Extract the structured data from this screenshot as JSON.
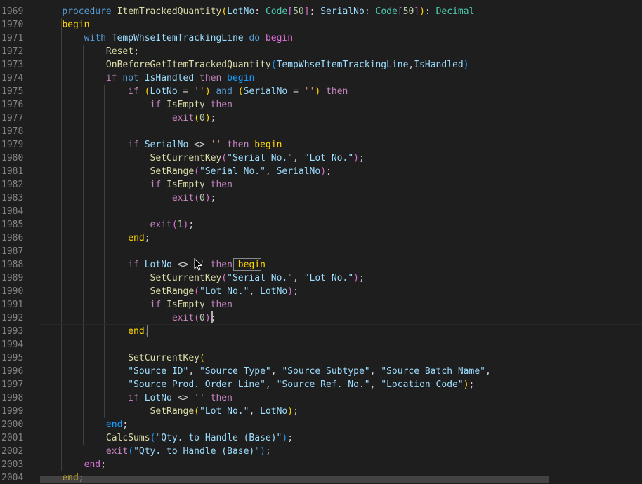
{
  "editor": {
    "lines": [
      {
        "num": "1969",
        "tokens": [
          [
            "    ",
            "t-txt"
          ],
          [
            "procedure",
            "t-kw"
          ],
          [
            " ",
            "t-txt"
          ],
          [
            "ItemTrackedQuantity",
            "t-fn"
          ],
          [
            "(",
            "t-yel"
          ],
          [
            "LotNo",
            "t-var"
          ],
          [
            ": ",
            "t-txt"
          ],
          [
            "Code",
            "t-type"
          ],
          [
            "[",
            "t-pink"
          ],
          [
            "50",
            "t-num"
          ],
          [
            "]",
            "t-pink"
          ],
          [
            "; ",
            "t-txt"
          ],
          [
            "SerialNo",
            "t-var"
          ],
          [
            ": ",
            "t-txt"
          ],
          [
            "Code",
            "t-type"
          ],
          [
            "[",
            "t-pink"
          ],
          [
            "50",
            "t-num"
          ],
          [
            "]",
            "t-pink"
          ],
          [
            ")",
            "t-yel"
          ],
          [
            ": ",
            "t-txt"
          ],
          [
            "Decimal",
            "t-type"
          ]
        ]
      },
      {
        "num": "1970",
        "tokens": [
          [
            "    ",
            "t-txt"
          ],
          [
            "begin",
            "t-yel"
          ]
        ]
      },
      {
        "num": "1971",
        "tokens": [
          [
            "        ",
            "t-txt"
          ],
          [
            "with",
            "t-kw"
          ],
          [
            " ",
            "t-txt"
          ],
          [
            "TempWhseItemTrackingLine",
            "t-var"
          ],
          [
            " ",
            "t-txt"
          ],
          [
            "do",
            "t-kw"
          ],
          [
            " ",
            "t-txt"
          ],
          [
            "begin",
            "t-pink"
          ]
        ]
      },
      {
        "num": "1972",
        "tokens": [
          [
            "            ",
            "t-txt"
          ],
          [
            "Reset",
            "t-fn"
          ],
          [
            ";",
            "t-txt"
          ]
        ]
      },
      {
        "num": "1973",
        "tokens": [
          [
            "            ",
            "t-txt"
          ],
          [
            "OnBeforeGetItemTrackedQuantity",
            "t-fn"
          ],
          [
            "(",
            "t-blue"
          ],
          [
            "TempWhseItemTrackingLine",
            "t-var"
          ],
          [
            ",",
            "t-txt"
          ],
          [
            "IsHandled",
            "t-var"
          ],
          [
            ")",
            "t-blue"
          ]
        ]
      },
      {
        "num": "1974",
        "tokens": [
          [
            "            ",
            "t-txt"
          ],
          [
            "if",
            "t-ctl"
          ],
          [
            " ",
            "t-txt"
          ],
          [
            "not",
            "t-kw"
          ],
          [
            " ",
            "t-txt"
          ],
          [
            "IsHandled",
            "t-var"
          ],
          [
            " ",
            "t-txt"
          ],
          [
            "then",
            "t-ctl"
          ],
          [
            " ",
            "t-txt"
          ],
          [
            "begin",
            "t-blue"
          ]
        ]
      },
      {
        "num": "1975",
        "tokens": [
          [
            "                ",
            "t-txt"
          ],
          [
            "if",
            "t-ctl"
          ],
          [
            " ",
            "t-txt"
          ],
          [
            "(",
            "t-yel"
          ],
          [
            "LotNo",
            "t-var"
          ],
          [
            " = ",
            "t-txt"
          ],
          [
            "''",
            "t-str"
          ],
          [
            ")",
            "t-yel"
          ],
          [
            " ",
            "t-txt"
          ],
          [
            "and",
            "t-kw"
          ],
          [
            " ",
            "t-txt"
          ],
          [
            "(",
            "t-yel"
          ],
          [
            "SerialNo",
            "t-var"
          ],
          [
            " = ",
            "t-txt"
          ],
          [
            "''",
            "t-str"
          ],
          [
            ")",
            "t-yel"
          ],
          [
            " ",
            "t-txt"
          ],
          [
            "then",
            "t-ctl"
          ]
        ]
      },
      {
        "num": "1976",
        "tokens": [
          [
            "                    ",
            "t-txt"
          ],
          [
            "if",
            "t-ctl"
          ],
          [
            " ",
            "t-txt"
          ],
          [
            "IsEmpty",
            "t-fn"
          ],
          [
            " ",
            "t-txt"
          ],
          [
            "then",
            "t-ctl"
          ]
        ]
      },
      {
        "num": "1977",
        "tokens": [
          [
            "                        ",
            "t-txt"
          ],
          [
            "exit",
            "t-ctl"
          ],
          [
            "(",
            "t-yel"
          ],
          [
            "0",
            "t-num"
          ],
          [
            ")",
            "t-yel"
          ],
          [
            ";",
            "t-txt"
          ]
        ]
      },
      {
        "num": "1978",
        "tokens": []
      },
      {
        "num": "1979",
        "tokens": [
          [
            "                ",
            "t-txt"
          ],
          [
            "if",
            "t-ctl"
          ],
          [
            " ",
            "t-txt"
          ],
          [
            "SerialNo",
            "t-var"
          ],
          [
            " <> ",
            "t-txt"
          ],
          [
            "''",
            "t-str"
          ],
          [
            " ",
            "t-txt"
          ],
          [
            "then",
            "t-ctl"
          ],
          [
            " ",
            "t-txt"
          ],
          [
            "begin",
            "t-yel"
          ]
        ]
      },
      {
        "num": "1980",
        "tokens": [
          [
            "                    ",
            "t-txt"
          ],
          [
            "SetCurrentKey",
            "t-fn"
          ],
          [
            "(",
            "t-pink"
          ],
          [
            "\"Serial No.\"",
            "t-var"
          ],
          [
            ", ",
            "t-txt"
          ],
          [
            "\"Lot No.\"",
            "t-var"
          ],
          [
            ")",
            "t-pink"
          ],
          [
            ";",
            "t-txt"
          ]
        ]
      },
      {
        "num": "1981",
        "tokens": [
          [
            "                    ",
            "t-txt"
          ],
          [
            "SetRange",
            "t-fn"
          ],
          [
            "(",
            "t-pink"
          ],
          [
            "\"Serial No.\"",
            "t-var"
          ],
          [
            ", ",
            "t-txt"
          ],
          [
            "SerialNo",
            "t-var"
          ],
          [
            ")",
            "t-pink"
          ],
          [
            ";",
            "t-txt"
          ]
        ]
      },
      {
        "num": "1982",
        "tokens": [
          [
            "                    ",
            "t-txt"
          ],
          [
            "if",
            "t-ctl"
          ],
          [
            " ",
            "t-txt"
          ],
          [
            "IsEmpty",
            "t-fn"
          ],
          [
            " ",
            "t-txt"
          ],
          [
            "then",
            "t-ctl"
          ]
        ]
      },
      {
        "num": "1983",
        "tokens": [
          [
            "                        ",
            "t-txt"
          ],
          [
            "exit",
            "t-ctl"
          ],
          [
            "(",
            "t-pink"
          ],
          [
            "0",
            "t-num"
          ],
          [
            ")",
            "t-pink"
          ],
          [
            ";",
            "t-txt"
          ]
        ]
      },
      {
        "num": "1984",
        "tokens": []
      },
      {
        "num": "1985",
        "tokens": [
          [
            "                    ",
            "t-txt"
          ],
          [
            "exit",
            "t-ctl"
          ],
          [
            "(",
            "t-pink"
          ],
          [
            "1",
            "t-num"
          ],
          [
            ")",
            "t-pink"
          ],
          [
            ";",
            "t-txt"
          ]
        ]
      },
      {
        "num": "1986",
        "tokens": [
          [
            "                ",
            "t-txt"
          ],
          [
            "end",
            "t-yel"
          ],
          [
            ";",
            "t-txt"
          ]
        ]
      },
      {
        "num": "1987",
        "tokens": []
      },
      {
        "num": "1988",
        "tokens": [
          [
            "                ",
            "t-txt"
          ],
          [
            "if",
            "t-ctl"
          ],
          [
            " ",
            "t-txt"
          ],
          [
            "LotNo",
            "t-var"
          ],
          [
            " <> ",
            "t-txt"
          ],
          [
            "''",
            "t-str"
          ],
          [
            " ",
            "t-txt"
          ],
          [
            "then",
            "t-ctl"
          ],
          [
            " ",
            "t-txt"
          ],
          [
            "begin",
            "t-yel"
          ]
        ]
      },
      {
        "num": "1989",
        "tokens": [
          [
            "                    ",
            "t-txt"
          ],
          [
            "SetCurrentKey",
            "t-fn"
          ],
          [
            "(",
            "t-pink"
          ],
          [
            "\"Serial No.\"",
            "t-var"
          ],
          [
            ", ",
            "t-txt"
          ],
          [
            "\"Lot No.\"",
            "t-var"
          ],
          [
            ")",
            "t-pink"
          ],
          [
            ";",
            "t-txt"
          ]
        ]
      },
      {
        "num": "1990",
        "tokens": [
          [
            "                    ",
            "t-txt"
          ],
          [
            "SetRange",
            "t-fn"
          ],
          [
            "(",
            "t-pink"
          ],
          [
            "\"Lot No.\"",
            "t-var"
          ],
          [
            ", ",
            "t-txt"
          ],
          [
            "LotNo",
            "t-var"
          ],
          [
            ")",
            "t-pink"
          ],
          [
            ";",
            "t-txt"
          ]
        ]
      },
      {
        "num": "1991",
        "tokens": [
          [
            "                    ",
            "t-txt"
          ],
          [
            "if",
            "t-ctl"
          ],
          [
            " ",
            "t-txt"
          ],
          [
            "IsEmpty",
            "t-fn"
          ],
          [
            " ",
            "t-txt"
          ],
          [
            "then",
            "t-ctl"
          ]
        ]
      },
      {
        "num": "1992",
        "tokens": [
          [
            "                        ",
            "t-txt"
          ],
          [
            "exit",
            "t-ctl"
          ],
          [
            "(",
            "t-pink"
          ],
          [
            "0",
            "t-num"
          ],
          [
            ")",
            "t-pink"
          ],
          [
            ";",
            "t-txt"
          ]
        ]
      },
      {
        "num": "1993",
        "tokens": [
          [
            "                ",
            "t-txt"
          ],
          [
            "end",
            "t-yel"
          ],
          [
            ";",
            "t-txt"
          ]
        ]
      },
      {
        "num": "1994",
        "tokens": []
      },
      {
        "num": "1995",
        "tokens": [
          [
            "                ",
            "t-txt"
          ],
          [
            "SetCurrentKey",
            "t-fn"
          ],
          [
            "(",
            "t-yel"
          ]
        ]
      },
      {
        "num": "1996",
        "tokens": [
          [
            "                ",
            "t-txt"
          ],
          [
            "\"Source ID\"",
            "t-var"
          ],
          [
            ", ",
            "t-txt"
          ],
          [
            "\"Source Type\"",
            "t-var"
          ],
          [
            ", ",
            "t-txt"
          ],
          [
            "\"Source Subtype\"",
            "t-var"
          ],
          [
            ", ",
            "t-txt"
          ],
          [
            "\"Source Batch Name\"",
            "t-var"
          ],
          [
            ",",
            "t-txt"
          ]
        ]
      },
      {
        "num": "1997",
        "tokens": [
          [
            "                ",
            "t-txt"
          ],
          [
            "\"Source Prod. Order Line\"",
            "t-var"
          ],
          [
            ", ",
            "t-txt"
          ],
          [
            "\"Source Ref. No.\"",
            "t-var"
          ],
          [
            ", ",
            "t-txt"
          ],
          [
            "\"Location Code\"",
            "t-var"
          ],
          [
            ")",
            "t-yel"
          ],
          [
            ";",
            "t-txt"
          ]
        ]
      },
      {
        "num": "1998",
        "tokens": [
          [
            "                ",
            "t-txt"
          ],
          [
            "if",
            "t-ctl"
          ],
          [
            " ",
            "t-txt"
          ],
          [
            "LotNo",
            "t-var"
          ],
          [
            " <> ",
            "t-txt"
          ],
          [
            "''",
            "t-str"
          ],
          [
            " ",
            "t-txt"
          ],
          [
            "then",
            "t-ctl"
          ]
        ]
      },
      {
        "num": "1999",
        "tokens": [
          [
            "                    ",
            "t-txt"
          ],
          [
            "SetRange",
            "t-fn"
          ],
          [
            "(",
            "t-yel"
          ],
          [
            "\"Lot No.\"",
            "t-var"
          ],
          [
            ", ",
            "t-txt"
          ],
          [
            "LotNo",
            "t-var"
          ],
          [
            ")",
            "t-yel"
          ],
          [
            ";",
            "t-txt"
          ]
        ]
      },
      {
        "num": "2000",
        "tokens": [
          [
            "            ",
            "t-txt"
          ],
          [
            "end",
            "t-blue"
          ],
          [
            ";",
            "t-txt"
          ]
        ]
      },
      {
        "num": "2001",
        "tokens": [
          [
            "            ",
            "t-txt"
          ],
          [
            "CalcSums",
            "t-fn"
          ],
          [
            "(",
            "t-blue"
          ],
          [
            "\"Qty. to Handle (Base)\"",
            "t-var"
          ],
          [
            ")",
            "t-blue"
          ],
          [
            ";",
            "t-txt"
          ]
        ]
      },
      {
        "num": "2002",
        "tokens": [
          [
            "            ",
            "t-txt"
          ],
          [
            "exit",
            "t-ctl"
          ],
          [
            "(",
            "t-blue"
          ],
          [
            "\"Qty. to Handle (Base)\"",
            "t-var"
          ],
          [
            ")",
            "t-blue"
          ],
          [
            ";",
            "t-txt"
          ]
        ]
      },
      {
        "num": "2003",
        "tokens": [
          [
            "        ",
            "t-txt"
          ],
          [
            "end",
            "t-pink"
          ],
          [
            ";",
            "t-txt"
          ]
        ]
      },
      {
        "num": "2004",
        "tokens": [
          [
            "    ",
            "t-txt"
          ],
          [
            "end",
            "t-yel"
          ],
          [
            ";",
            "t-txt"
          ]
        ]
      }
    ]
  }
}
